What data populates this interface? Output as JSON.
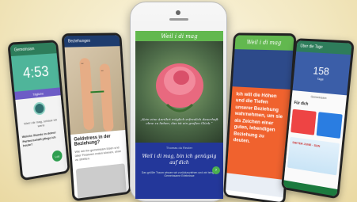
{
  "card1": {
    "title": "Gemeinsam",
    "timer": "4:53",
    "label": "Tägliche",
    "sub": "Weil i dir mag, schaue ich wenn",
    "question": "Welche Stunde in deiner Partnerschaft pflege ich heute?",
    "action": "Los"
  },
  "card2": {
    "title": "Beziehungen",
    "heading": "Geldstress in der Beziehung?",
    "body": "Wie wir ihn gemeinsam lösen und über Finanzen reden können, ohne zu streiten."
  },
  "phone": {
    "brand": "Weil i di mag",
    "quote": "„Kein eine Anrührt möglich erfreulich dauerhaft ohne zu lieben, das ist ein großes Glück.“",
    "credit": "Thomas du Reuter",
    "cta": "Weil i di mag, bin ich genügsig auf dich",
    "foot": "Das größte Traum wissen wir zurückzuziehen und wir bringen Gemeinsame Erlebnisse"
  },
  "card4": {
    "brand": "Weil i di mag",
    "text": "Ich will die Höhen und die Tiefen unserer Beziehung wahrnehmen, um sie als Zeichen einer guten, lebendigen Beziehung zu deuten."
  },
  "card5": {
    "title": "Über die Tage",
    "count": "158",
    "unit": "Tage",
    "sub": "Gemeinsam",
    "section": "Für dich",
    "names": "DIETER JUNE · SUN"
  }
}
